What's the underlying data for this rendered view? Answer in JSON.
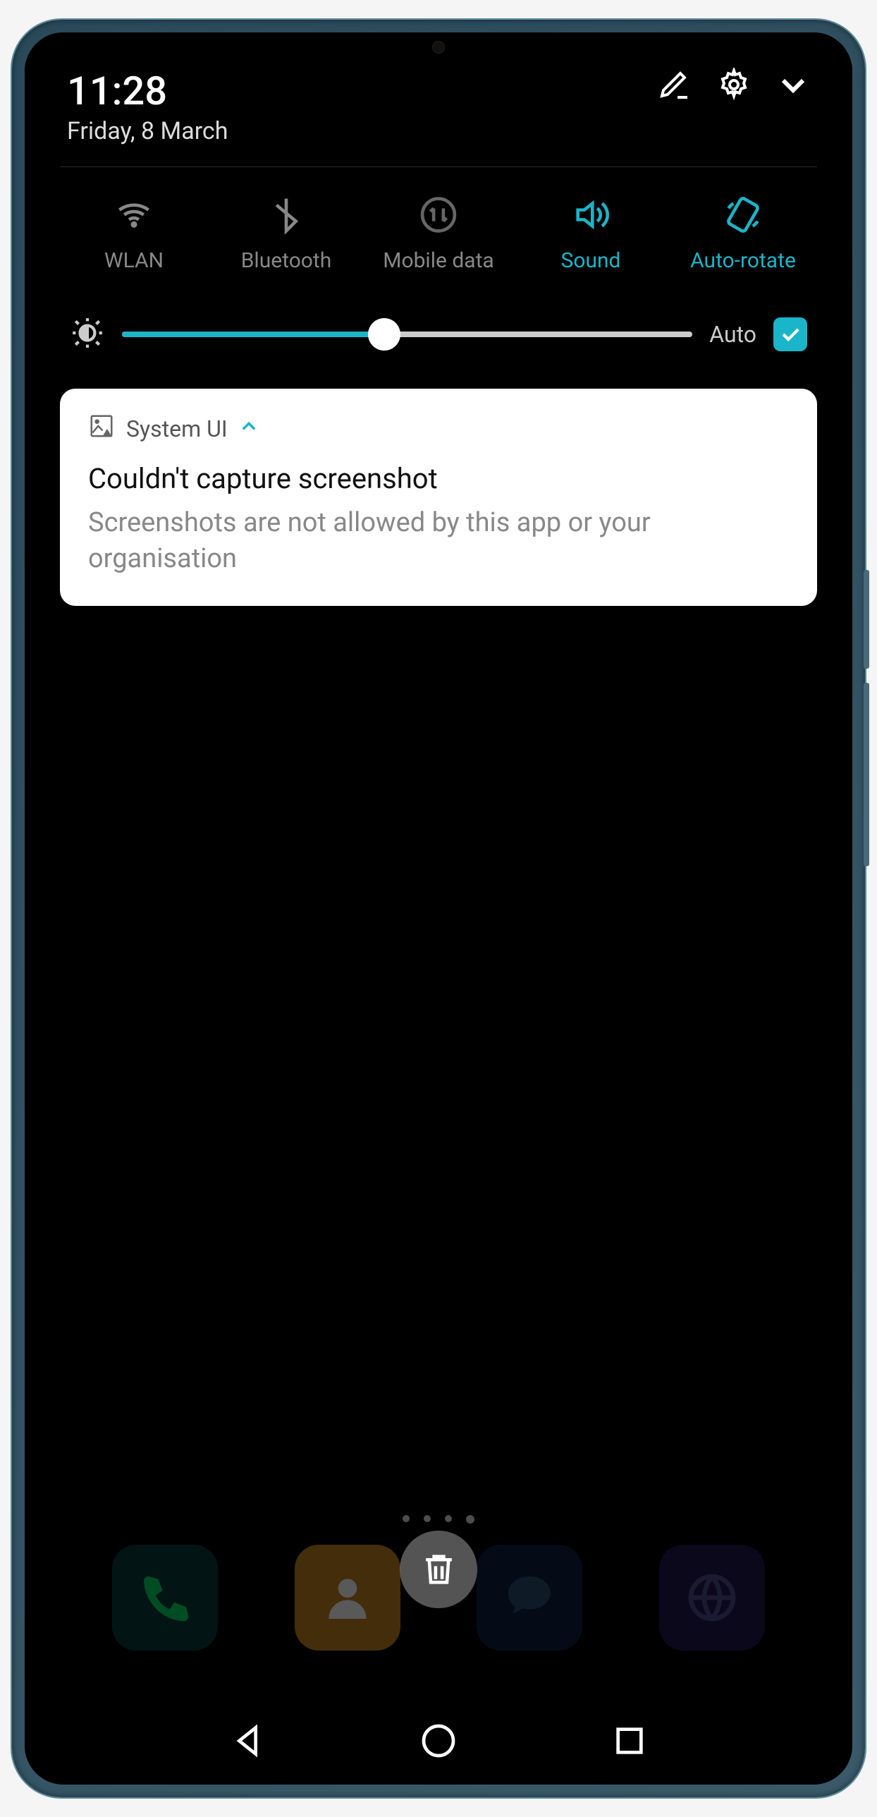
{
  "header": {
    "time": "11:28",
    "date": "Friday, 8 March"
  },
  "quick_settings": {
    "items": [
      {
        "label": "WLAN",
        "active": false
      },
      {
        "label": "Bluetooth",
        "active": false
      },
      {
        "label": "Mobile data",
        "active": false
      },
      {
        "label": "Sound",
        "active": true
      },
      {
        "label": "Auto-rotate",
        "active": true
      }
    ]
  },
  "brightness": {
    "auto_label": "Auto",
    "auto_checked": true,
    "value_pct": 46
  },
  "notification": {
    "app_name": "System UI",
    "title": "Couldn't capture screenshot",
    "body": "Screenshots are not allowed by this app or your organisation"
  }
}
